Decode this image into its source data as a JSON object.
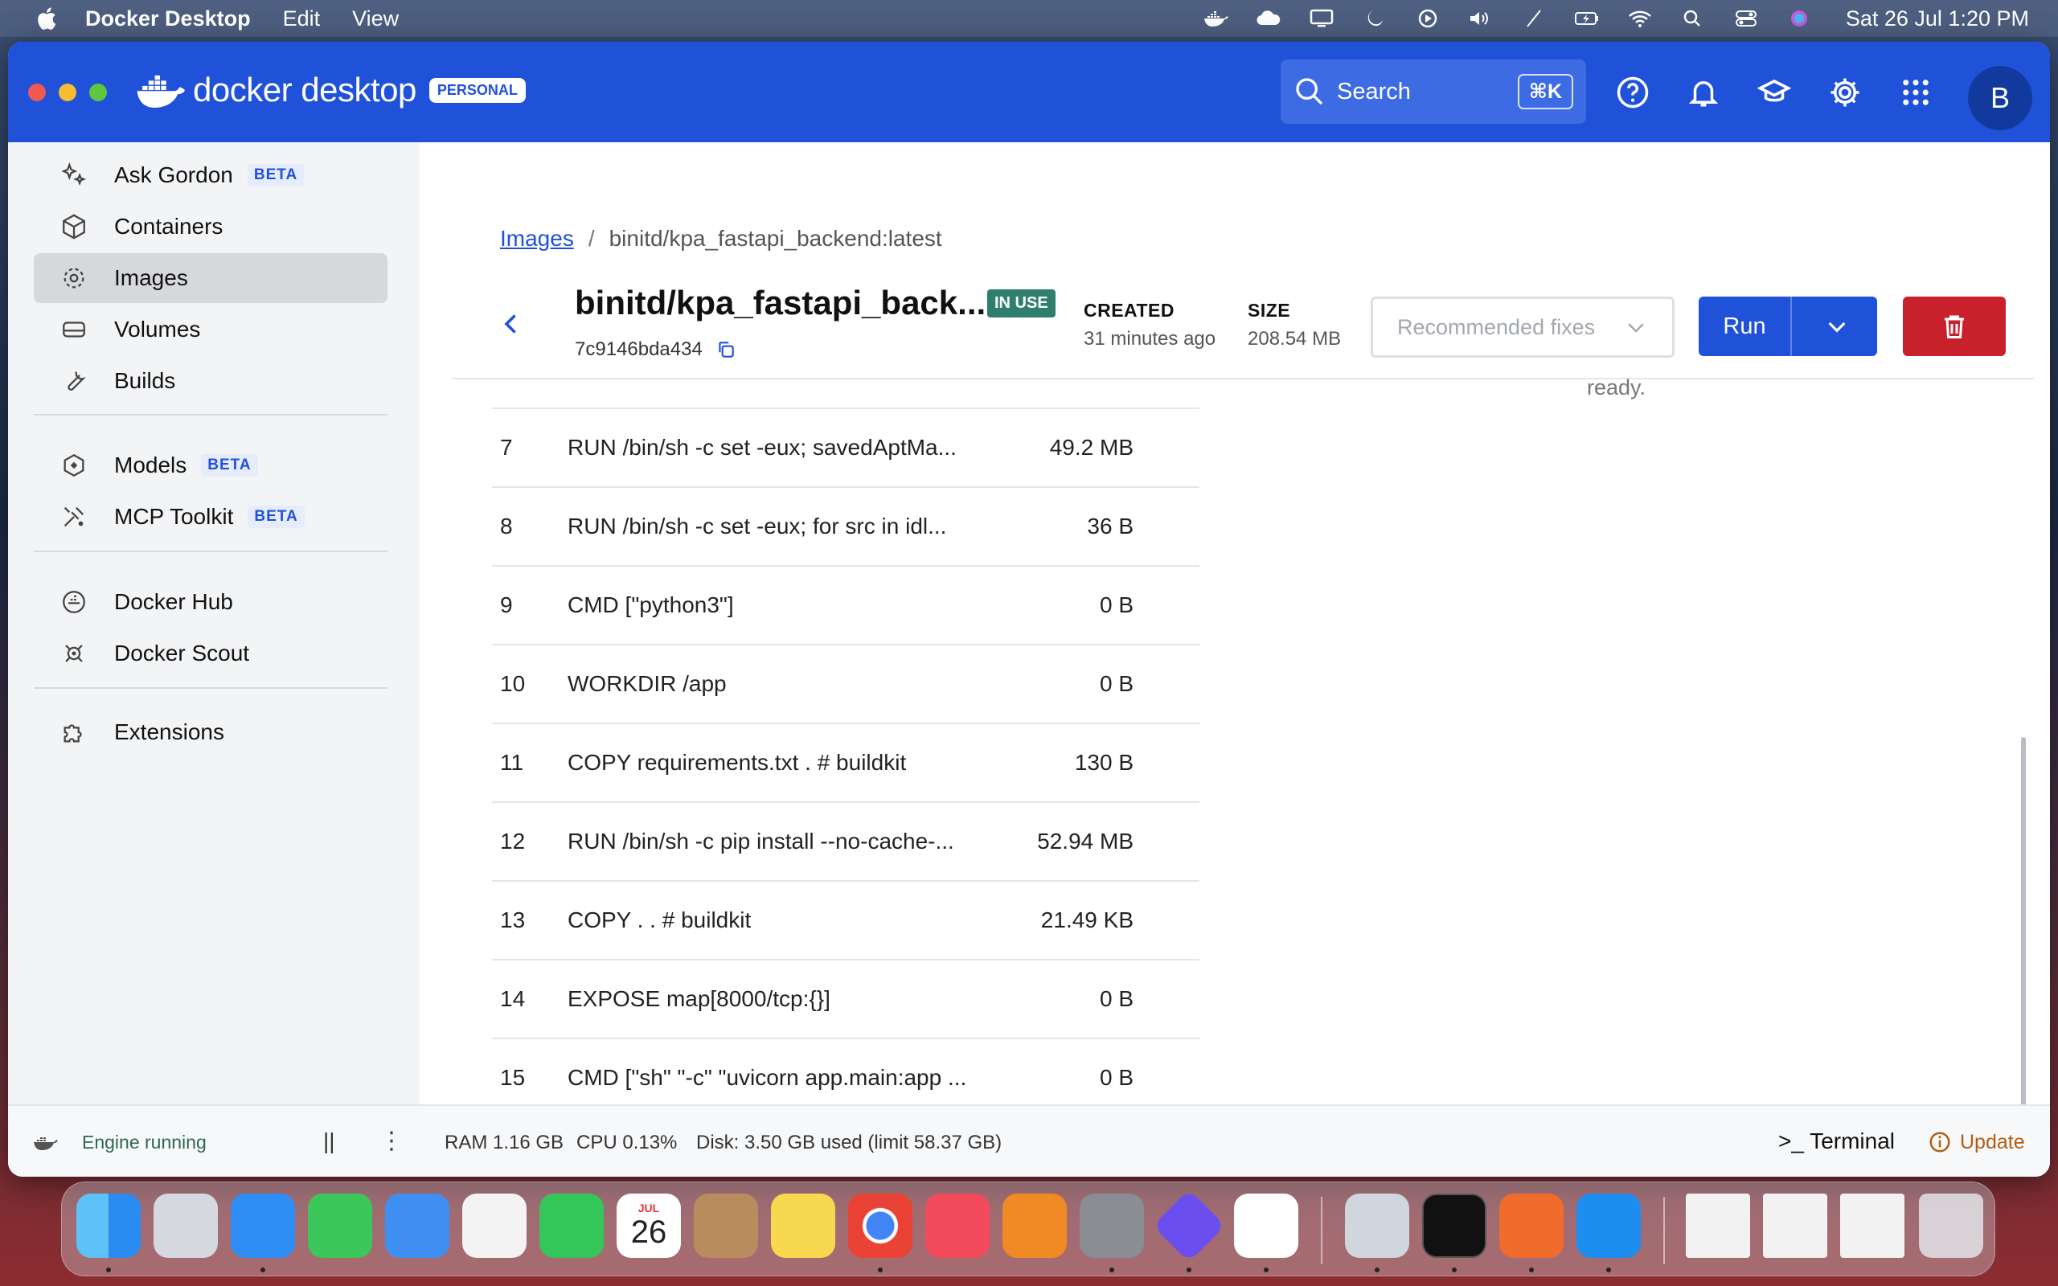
{
  "menubar": {
    "app_name": "Docker Desktop",
    "menus": [
      "Edit",
      "View"
    ],
    "clock": "Sat 26 Jul  1:20 PM",
    "status_icons": [
      "docker-icon",
      "cloud-icon",
      "display-icon",
      "moon-icon",
      "play-icon",
      "volume-icon",
      "pen-icon",
      "battery-icon",
      "wifi-icon",
      "search-icon",
      "control-center-icon",
      "siri-icon"
    ]
  },
  "titlebar": {
    "brand": "docker desktop",
    "plan_badge": "PERSONAL",
    "search_label": "Search",
    "search_shortcut": "⌘K",
    "avatar_initial": "B",
    "brand_color": "#2051d9"
  },
  "sidebar": {
    "items": [
      {
        "label": "Ask Gordon",
        "badge": "BETA",
        "icon": "sparkle-icon"
      },
      {
        "label": "Containers",
        "icon": "box-icon"
      },
      {
        "label": "Images",
        "icon": "image-layers-icon",
        "active": true
      },
      {
        "label": "Volumes",
        "icon": "drive-icon"
      },
      {
        "label": "Builds",
        "icon": "wrench-icon"
      },
      {
        "label": "Models",
        "badge": "BETA",
        "icon": "cube-icon"
      },
      {
        "label": "MCP Toolkit",
        "badge": "BETA",
        "icon": "toolkit-icon"
      },
      {
        "label": "Docker Hub",
        "icon": "hub-icon"
      },
      {
        "label": "Docker Scout",
        "icon": "scout-icon"
      },
      {
        "label": "Extensions",
        "icon": "puzzle-icon"
      }
    ]
  },
  "main": {
    "breadcrumb": {
      "link": "Images",
      "separator": "/",
      "current": "binitd/kpa_fastapi_backend:latest"
    },
    "image": {
      "title": "binitd/kpa_fastapi_back...",
      "status": "IN USE",
      "id": "7c9146bda434",
      "created_label": "CREATED",
      "created_value": "31 minutes ago",
      "size_label": "SIZE",
      "size_value": "208.54 MB"
    },
    "actions": {
      "recommended": "Recommended fixes",
      "run": "Run"
    },
    "ready_text": "ready.",
    "layers": [
      {
        "num": "7",
        "cmd": "RUN /bin/sh -c set -eux; savedAptMa...",
        "size": "49.2 MB"
      },
      {
        "num": "8",
        "cmd": "RUN /bin/sh -c set -eux; for src in idl...",
        "size": "36 B"
      },
      {
        "num": "9",
        "cmd": "CMD [\"python3\"]",
        "size": "0 B"
      },
      {
        "num": "10",
        "cmd": "WORKDIR /app",
        "size": "0 B"
      },
      {
        "num": "11",
        "cmd": "COPY requirements.txt . # buildkit",
        "size": "130 B"
      },
      {
        "num": "12",
        "cmd": "RUN /bin/sh -c pip install --no-cache-...",
        "size": "52.94 MB"
      },
      {
        "num": "13",
        "cmd": "COPY . . # buildkit",
        "size": "21.49 KB"
      },
      {
        "num": "14",
        "cmd": "EXPOSE map[8000/tcp:{}]",
        "size": "0 B"
      },
      {
        "num": "15",
        "cmd": "CMD [\"sh\" \"-c\" \"uvicorn app.main:app ...",
        "size": "0 B"
      }
    ]
  },
  "statusbar": {
    "engine": "Engine running",
    "pause": "||",
    "more": "⋮",
    "ram": "RAM 1.16 GB",
    "cpu": "CPU 0.13%",
    "disk": "Disk: 3.50 GB used (limit 58.37 GB)",
    "terminal": ">_ Terminal",
    "update": "Update"
  },
  "dock": {
    "calendar_month": "JUL",
    "calendar_day": "26",
    "apps": [
      "Finder",
      "Launchpad",
      "Safari",
      "Messages",
      "Mail",
      "Photos",
      "FaceTime",
      "Calendar",
      "Contacts",
      "Notes",
      "Chrome",
      "Music",
      "Books",
      "System Settings",
      "Prompt",
      "VS Code",
      "Preview",
      "Terminal",
      "Postman",
      "Docker",
      "Trash"
    ]
  }
}
